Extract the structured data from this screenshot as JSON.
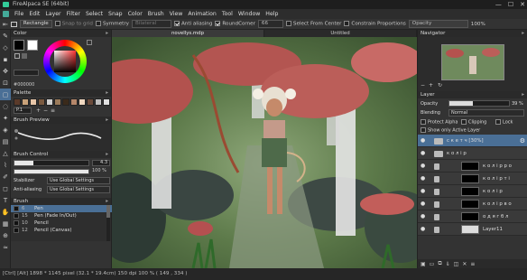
{
  "window": {
    "title": "FireAlpaca SE (64bit)",
    "controls": [
      "—",
      "☐",
      "✕"
    ]
  },
  "menu": [
    "File",
    "Edit",
    "Layer",
    "Filter",
    "Select",
    "Snap",
    "Color",
    "Brush",
    "View",
    "Animation",
    "Tool",
    "Window",
    "Help"
  ],
  "toolbar": {
    "shape_label": "Rectangle",
    "snap_to_grid": "Snap to grid",
    "symmetry": "Symmetry",
    "symmetry_mode": "Bilateral",
    "anti_aliasing": "Anti aliasing",
    "round_corner_label": "RoundCorner",
    "round_corner_value": "66",
    "select_from_center": "Select From Center",
    "constrain_proportions": "Constrain Proportions",
    "opacity_label": "Opacity",
    "opacity_value": "100%"
  },
  "panels": {
    "color": {
      "title": "Color",
      "hex": "#000000",
      "accent": "#4a6f96"
    },
    "palette": {
      "title": "Palette",
      "page": "P.1",
      "swatches": [
        "#5a3a2a",
        "#c9a27a",
        "#e8c6a8",
        "#7a5a40",
        "#d2d2d2",
        "#9b7b5b",
        "#3a2a1a",
        "#b5876a",
        "#f0d8c0",
        "#6a4a3a",
        "#c0c0c0",
        "#e0e0e0"
      ]
    },
    "brush_preview": {
      "title": "Brush Preview"
    },
    "brush_control": {
      "title": "Brush Control",
      "size_value": "4.3",
      "opacity_value": "100 %",
      "stabilizer_label": "Stabilizer",
      "stabilizer_value": "Use Global Settings",
      "anti_aliasing_label": "Anti-aliasing",
      "anti_aliasing_value": "Use Global Settings"
    },
    "brush_list": {
      "title": "Brush",
      "items": [
        {
          "size": "6",
          "name": "Pen"
        },
        {
          "size": "15",
          "name": "Pen (Fade In/Out)"
        },
        {
          "size": "10",
          "name": "Pencil"
        },
        {
          "size": "12",
          "name": "Pencil (Canvas)"
        }
      ]
    }
  },
  "tabs": [
    "novellys.mdp",
    "Untitled"
  ],
  "navigator": {
    "title": "Navigator"
  },
  "layer_panel": {
    "title": "Layer",
    "opacity_label": "Opacity",
    "opacity_value": "39 %",
    "blending_label": "Blending",
    "blending_value": "Normal",
    "protect_alpha": "Protect Alpha",
    "clipping": "Clipping",
    "lock": "Lock",
    "show_only_active": "Show only Active Layer",
    "layers": [
      {
        "name": "с к е т ч [30%]",
        "kind": "folder",
        "selected": true
      },
      {
        "name": "к о л і р",
        "kind": "folder",
        "selected": false
      },
      {
        "name": "к о л і р р о",
        "kind": "layer",
        "selected": false
      },
      {
        "name": "к о л і р т і",
        "kind": "layer",
        "selected": false
      },
      {
        "name": "к о л і р",
        "kind": "layer",
        "selected": false
      },
      {
        "name": "к о л і р в о",
        "kind": "layer",
        "selected": false
      },
      {
        "name": "о д я г б л",
        "kind": "layer",
        "selected": false
      },
      {
        "name": "Layer11",
        "kind": "layer",
        "selected": false
      }
    ]
  },
  "statusbar": "[Ctrl] [Alt]  1898 * 1145 pixel  (32.1 * 19.4cm)  150 dpi  100 %  ( 149 , 334 )"
}
